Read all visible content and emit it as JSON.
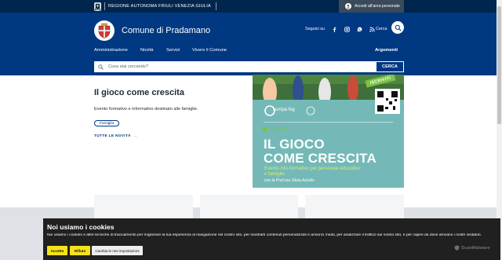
{
  "top_bar": {
    "region": "REGIONE AUTONOMA FRIULI VENEZIA GIULIA",
    "login": "Accedi all'area personale"
  },
  "header": {
    "title": "Comune di Pradamano",
    "follow_label": "Seguici su",
    "social_icons": [
      "facebook-icon",
      "instagram-icon",
      "whatsapp-icon",
      "rss-icon"
    ],
    "search_label": "Cerca"
  },
  "nav": {
    "items": [
      "Amministrazione",
      "Novità",
      "Servizi",
      "Vivere il Comune"
    ],
    "topics": "Argomenti"
  },
  "search": {
    "placeholder": "Cosa stai cercando?",
    "button": "CERCA"
  },
  "news": {
    "title": "Il gioco come crescita",
    "description": "Evento formativo e informativo destinato alle famiglie.",
    "tag": "Famiglia",
    "all_news": "TUTTE LE NOVITÀ"
  },
  "promo": {
    "ribbon": "ISCRIVITI",
    "brand": "compa fvg",
    "event_label": "EVENTI",
    "title_line1": "IL GIOCO",
    "title_line2": "COME CRESCITA",
    "subtitle_line1": "Evento info-formativo per personale educativo",
    "subtitle_line2": "e famiglie",
    "author": "con la Prof.ssa Silvia Azzolin"
  },
  "cookie": {
    "title": "Noi usiamo i cookies",
    "text": "Noi usiamo i cookies e altre tecniche di tracciamento per migliorare la tua esperienza di navigazione nel nostro sito, per mostrarti contenuti personalizzati e annunci mirati, per analizzare il traffico sul nostro sito, e per capire da dove arrivano i nostri visitatori.",
    "accept": "Accetto",
    "reject": "Rifiuto",
    "settings": "Cambia le mie impostazioni",
    "provider": "ScanMalware"
  },
  "colors": {
    "primary": "#003882",
    "dark": "#00264d",
    "accent_green": "#7cc242",
    "cookie_button": "#f5e21b"
  }
}
